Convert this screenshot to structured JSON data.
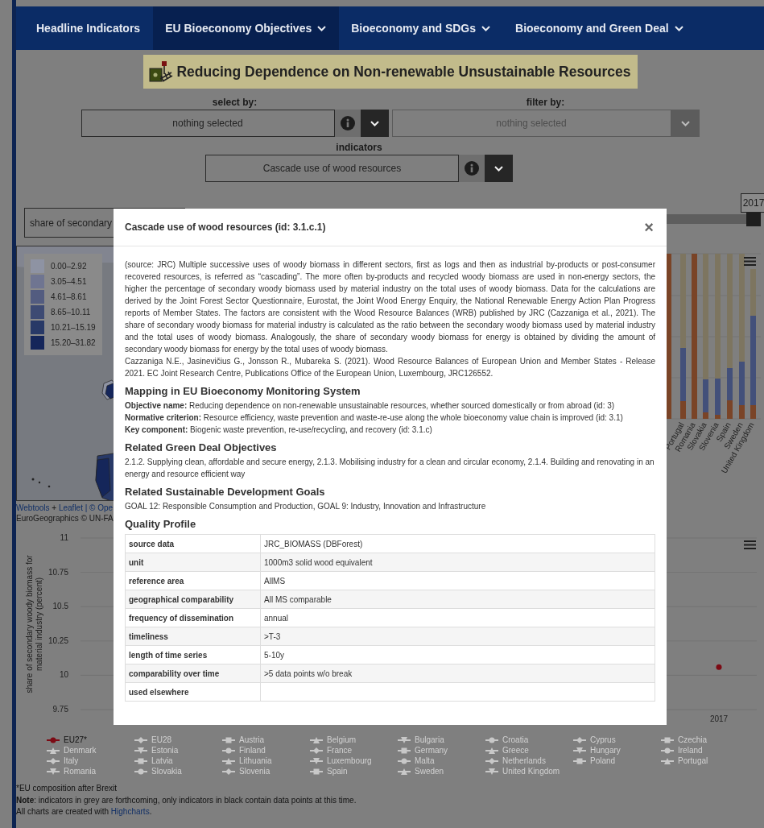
{
  "nav": {
    "items": [
      {
        "label": "Headline Indicators",
        "dropdown": false,
        "selected": false
      },
      {
        "label": "EU Bioeconomy Objectives",
        "dropdown": true,
        "selected": true
      },
      {
        "label": "Bioeconomy and SDGs",
        "dropdown": true,
        "selected": false
      },
      {
        "label": "Bioeconomy and Green Deal",
        "dropdown": true,
        "selected": false
      }
    ]
  },
  "page_title": "Reducing Dependence on Non-renewable Unsustainable Resources",
  "selectors": [
    {
      "label": "select by:",
      "value": "nothing selected",
      "info": true,
      "disabled": false
    },
    {
      "label": "filter by:",
      "value": "nothing selected",
      "info": false,
      "disabled": true
    }
  ],
  "indicator_selector": {
    "label": "indicators",
    "value": "Cascade use of wood resources",
    "info": true,
    "disabled": false
  },
  "variable_select": {
    "value": "share of secondary"
  },
  "year_slider": {
    "reading": "2017",
    "level": 1
  },
  "map": {
    "legend": [
      {
        "label": "0.00–2.92",
        "color": "#8e93a3"
      },
      {
        "label": "3.05–4.51",
        "color": "#6f7591"
      },
      {
        "label": "4.61–8.61",
        "color": "#535c80"
      },
      {
        "label": "8.65–10.11",
        "color": "#3d4a73"
      },
      {
        "label": "10.21–15.19",
        "color": "#283967"
      },
      {
        "label": "15.20–31.82",
        "color": "#15265a"
      }
    ],
    "attribution": [
      [
        {
          "text": "Webtools",
          "kind": "link"
        },
        {
          "text": " + ",
          "kind": "text"
        },
        {
          "text": "Leaflet",
          "kind": "link"
        },
        {
          "text": " | © Ope",
          "kind": "link"
        }
      ],
      [
        {
          "text": "EuroGeographics © UN-FA",
          "kind": "text"
        }
      ]
    ]
  },
  "bar_chart": {
    "labels": [
      "Portugal",
      "Romania",
      "Slovakia",
      "Slovenia",
      "Spain",
      "Sweden",
      "United Kingdom"
    ]
  },
  "line_chart": {
    "chart_data": {
      "type": "line",
      "ylabel": "share of secondary woody biomass for material industry (percent)",
      "ylim": [
        9.75,
        11
      ],
      "yticks": [
        {
          "value": 9.75,
          "label": "9.75"
        },
        {
          "value": 10,
          "label": "10"
        },
        {
          "value": 10.25,
          "label": "10.25"
        },
        {
          "value": 10.5,
          "label": "10.5"
        },
        {
          "value": 10.75,
          "label": "10.75"
        },
        {
          "value": 11,
          "label": "11"
        }
      ],
      "grid": true,
      "categories": [
        null,
        null,
        null,
        null,
        null,
        null,
        null,
        "2017"
      ],
      "series": [
        {
          "name": "EU27*",
          "color": "#7c0a14",
          "marker": "circle",
          "values": [
            null,
            null,
            null,
            null,
            null,
            null,
            null,
            10.06
          ]
        }
      ]
    },
    "legend": [
      {
        "label": "EU28",
        "selected": false
      },
      {
        "label": "Austria",
        "selected": false
      },
      {
        "label": "Belgium",
        "selected": false
      },
      {
        "label": "Bulgaria",
        "selected": false
      },
      {
        "label": "Croatia",
        "selected": false
      },
      {
        "label": "Cyprus",
        "selected": false
      },
      {
        "label": "Czechia",
        "selected": false
      },
      {
        "label": "Denmark",
        "selected": false
      },
      {
        "label": "Estonia",
        "selected": false
      },
      {
        "label": "Finland",
        "selected": false
      },
      {
        "label": "France",
        "selected": false
      },
      {
        "label": "Germany",
        "selected": false
      },
      {
        "label": "Greece",
        "selected": false
      },
      {
        "label": "Hungary",
        "selected": false
      },
      {
        "label": "Ireland",
        "selected": false
      },
      {
        "label": "Italy",
        "selected": false
      },
      {
        "label": "Latvia",
        "selected": false
      },
      {
        "label": "Lithuania",
        "selected": false
      },
      {
        "label": "Luxembourg",
        "selected": false
      },
      {
        "label": "Malta",
        "selected": false
      },
      {
        "label": "Netherlands",
        "selected": false
      },
      {
        "label": "Poland",
        "selected": false
      },
      {
        "label": "Portugal",
        "selected": false
      },
      {
        "label": "Romania",
        "selected": false
      },
      {
        "label": "Slovakia",
        "selected": false
      },
      {
        "label": "Slovenia",
        "selected": false
      },
      {
        "label": "Spain",
        "selected": false
      },
      {
        "label": "Sweden",
        "selected": false
      },
      {
        "label": "United Kingdom",
        "selected": false
      }
    ]
  },
  "footnotes": [
    "*EU composition after Brexit",
    "**Note**: indicators in grey are forthcoming, only indicators in black contain data points at this time."
  ],
  "credit": {
    "text": "All charts are created with ",
    "link": "Highcharts",
    "after": "."
  },
  "modal": {
    "title": "Cascade use of wood resources (id: 3.1.c.1)",
    "close": "×",
    "description": "(source: JRC) Multiple successive uses of woody biomass in different sectors, first as logs and then as industrial by-products or post-consumer recovered resources, is referred as “cascading”. The more often by-products and recycled woody biomass are used in non-energy sectors, the higher the percentage of secondary woody biomass used by material industry on the total uses of woody biomass. Data for the calculations are derived by the Joint Forest Sector Questionnaire, Eurostat, the Joint Wood Energy Enquiry, the National Renewable Energy Action Plan Progress reports of Member States. The factors are consistent with the Wood Resource Balances (WRB) published by JRC (Cazzaniga et al., 2021). The share of secondary woody biomass for material industry is calculated as the ratio between the secondary woody biomass used by material industry and the total uses of woody biomass. Analogously, the share of secondary woody biomass for energy is obtained by dividing the amount of secondary woody biomass for energy by the total uses of woody biomass.",
    "citation": "Cazzaniga N.E., Jasinevičius G., Jonsson R., Mubareka S. (2021). Wood Resource Balances of European Union and Member States - Release 2021. EC Joint Research Centre, Publications Office of the European Union, Luxembourg, JRC126552.",
    "sections": [
      {
        "heading": "Mapping in EU Bioeconomy Monitoring System",
        "lines": [
          "**Objective name:** Reducing dependence on non-renewable unsustainable resources, whether sourced domestically or from abroad (id: 3)",
          "**Normative criterion:** Resource efficiency, waste prevention and waste-re-use along the whole bioeconomy value chain is improved (id: 3.1)",
          "**Key component:** Biogenic waste prevention, re-use/recycling, and recovery (id: 3.1.c)"
        ]
      },
      {
        "heading": "Related Green Deal Objectives",
        "lines": [
          "2.1.2. Supplying clean, affordable and secure energy, 2.1.3. Mobilising industry for a clean and circular economy, 2.1.4. Building and renovating in an energy and resource efficient way"
        ]
      },
      {
        "heading": "Related Sustainable Development Goals",
        "lines": [
          "GOAL 12: Responsible Consumption and Production, GOAL 9: Industry, Innovation and Infrastructure"
        ]
      }
    ],
    "quality_heading": "Quality Profile",
    "quality": [
      {
        "name": "source data",
        "value": "JRC_BIOMASS (DBForest)"
      },
      {
        "name": "unit",
        "value": "1000m3 solid wood equivalent"
      },
      {
        "name": "reference area",
        "value": "AllMS"
      },
      {
        "name": "geographical comparability",
        "value": "All MS comparable"
      },
      {
        "name": "frequency of dissemination",
        "value": "annual"
      },
      {
        "name": "timeliness",
        "value": ">T-3"
      },
      {
        "name": "length of time series",
        "value": "5-10y"
      },
      {
        "name": "comparability over time",
        "value": ">5 data points w/o break"
      },
      {
        "name": "used elsewhere"
      }
    ]
  }
}
